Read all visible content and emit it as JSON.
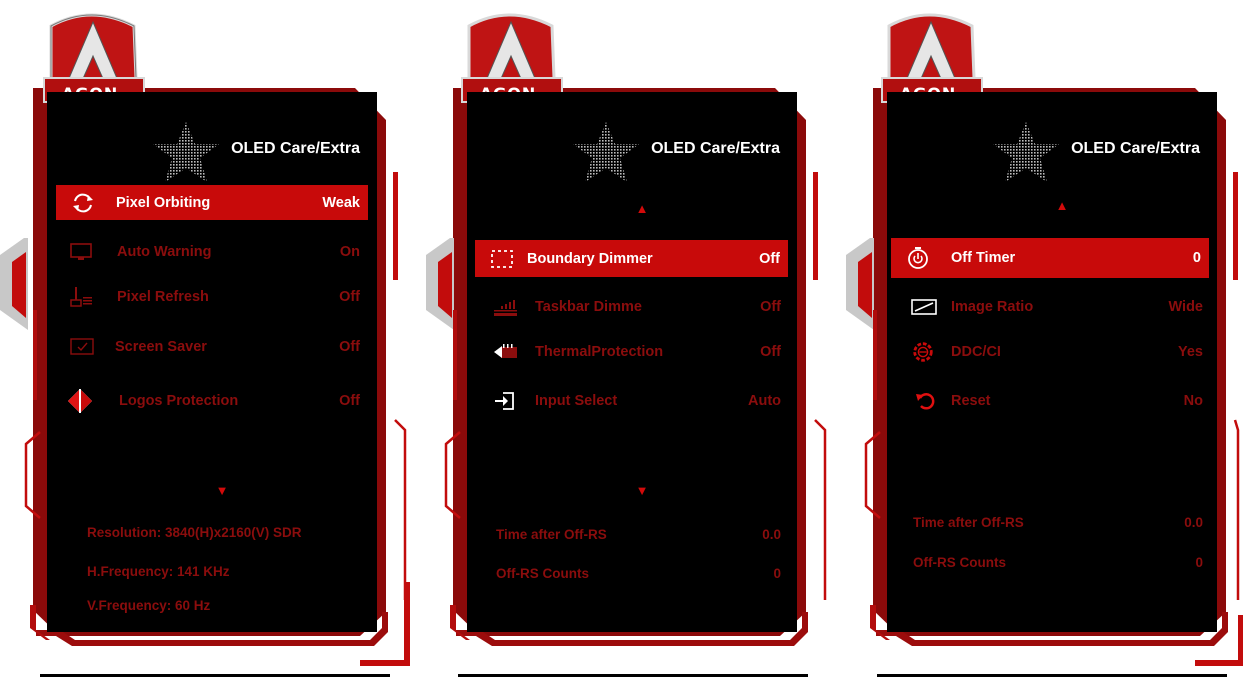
{
  "brand": "AGON",
  "accent_color": "#c80a0a",
  "dim_text_color": "#8b0d0d",
  "panels": [
    {
      "title": "OLED Care/Extra",
      "up_arrow": "",
      "down_arrow": "▼",
      "items": [
        {
          "icon": "pixel-orbit-icon",
          "label": "Pixel Orbiting",
          "value": "Weak",
          "selected": true
        },
        {
          "icon": "monitor-warning-icon",
          "label": "Auto Warning",
          "value": "On"
        },
        {
          "icon": "pixel-refresh-icon",
          "label": "Pixel Refresh",
          "value": "Off"
        },
        {
          "icon": "screen-saver-icon",
          "label": "Screen Saver",
          "value": "Off"
        },
        {
          "icon": "logo-protection-icon",
          "label": "Logos Protection",
          "value": "Off"
        }
      ],
      "info": [
        {
          "label": "Resolution: 3840(H)x2160(V) SDR",
          "value": ""
        },
        {
          "label": "H.Frequency: 141 KHz",
          "value": ""
        },
        {
          "label": "V.Frequency: 60 Hz",
          "value": ""
        }
      ]
    },
    {
      "title": "OLED Care/Extra",
      "up_arrow": "▲",
      "down_arrow": "▼",
      "items": [
        {
          "icon": "boundary-dimmer-icon",
          "label": "Boundary Dimmer",
          "value": "Off",
          "selected": true
        },
        {
          "icon": "taskbar-dimmer-icon",
          "label": "Taskbar Dimme",
          "value": "Off"
        },
        {
          "icon": "thermal-protection-icon",
          "label": "ThermalProtection",
          "value": "Off"
        },
        {
          "icon": "input-select-icon",
          "label": "Input Select",
          "value": "Auto"
        }
      ],
      "info": [
        {
          "label": "Time after Off-RS",
          "value": "0.0"
        },
        {
          "label": "Off-RS Counts",
          "value": "0"
        }
      ]
    },
    {
      "title": "OLED Care/Extra",
      "up_arrow": "▲",
      "down_arrow": "",
      "items": [
        {
          "icon": "off-timer-icon",
          "label": "Off Timer",
          "value": "0",
          "selected": true
        },
        {
          "icon": "image-ratio-icon",
          "label": "Image Ratio",
          "value": "Wide"
        },
        {
          "icon": "ddc-ci-icon",
          "label": "DDC/CI",
          "value": "Yes"
        },
        {
          "icon": "reset-icon",
          "label": "Reset",
          "value": "No"
        }
      ],
      "info": [
        {
          "label": "Time after Off-RS",
          "value": "0.0"
        },
        {
          "label": "Off-RS Counts",
          "value": "0"
        }
      ]
    }
  ]
}
